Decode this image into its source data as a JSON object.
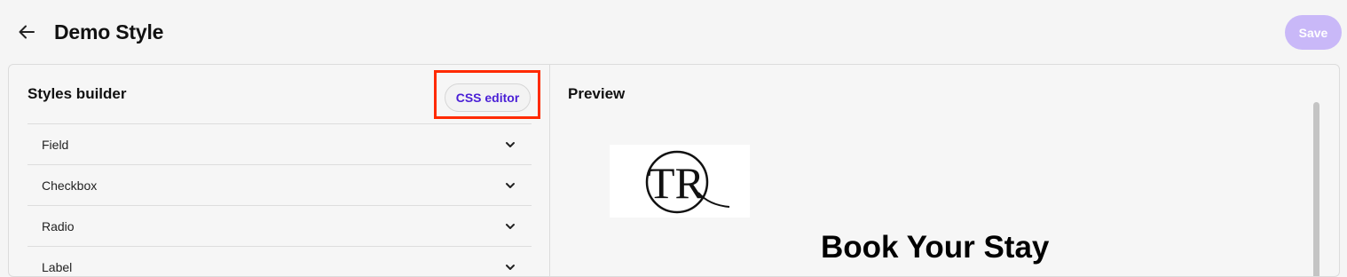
{
  "header": {
    "title": "Demo Style",
    "back_icon": "arrow-left-icon",
    "save_label": "Save",
    "save_color": "#c9b8f8"
  },
  "builder": {
    "title": "Styles builder",
    "css_editor_label": "CSS editor",
    "highlight_color": "#ff2a00",
    "items": [
      {
        "label": "Field",
        "icon": "chevron-down-icon"
      },
      {
        "label": "Checkbox",
        "icon": "chevron-down-icon"
      },
      {
        "label": "Radio",
        "icon": "chevron-down-icon"
      },
      {
        "label": "Label",
        "icon": "chevron-down-icon"
      }
    ]
  },
  "preview": {
    "title": "Preview",
    "logo_text": "TR",
    "heading": "Book Your Stay"
  }
}
